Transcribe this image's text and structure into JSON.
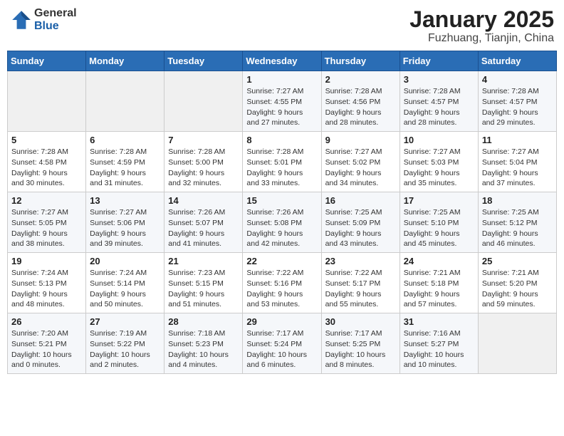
{
  "header": {
    "logo_general": "General",
    "logo_blue": "Blue",
    "month_year": "January 2025",
    "location": "Fuzhuang, Tianjin, China"
  },
  "weekdays": [
    "Sunday",
    "Monday",
    "Tuesday",
    "Wednesday",
    "Thursday",
    "Friday",
    "Saturday"
  ],
  "weeks": [
    [
      {
        "day": "",
        "detail": ""
      },
      {
        "day": "",
        "detail": ""
      },
      {
        "day": "",
        "detail": ""
      },
      {
        "day": "1",
        "detail": "Sunrise: 7:27 AM\nSunset: 4:55 PM\nDaylight: 9 hours\nand 27 minutes."
      },
      {
        "day": "2",
        "detail": "Sunrise: 7:28 AM\nSunset: 4:56 PM\nDaylight: 9 hours\nand 28 minutes."
      },
      {
        "day": "3",
        "detail": "Sunrise: 7:28 AM\nSunset: 4:57 PM\nDaylight: 9 hours\nand 28 minutes."
      },
      {
        "day": "4",
        "detail": "Sunrise: 7:28 AM\nSunset: 4:57 PM\nDaylight: 9 hours\nand 29 minutes."
      }
    ],
    [
      {
        "day": "5",
        "detail": "Sunrise: 7:28 AM\nSunset: 4:58 PM\nDaylight: 9 hours\nand 30 minutes."
      },
      {
        "day": "6",
        "detail": "Sunrise: 7:28 AM\nSunset: 4:59 PM\nDaylight: 9 hours\nand 31 minutes."
      },
      {
        "day": "7",
        "detail": "Sunrise: 7:28 AM\nSunset: 5:00 PM\nDaylight: 9 hours\nand 32 minutes."
      },
      {
        "day": "8",
        "detail": "Sunrise: 7:28 AM\nSunset: 5:01 PM\nDaylight: 9 hours\nand 33 minutes."
      },
      {
        "day": "9",
        "detail": "Sunrise: 7:27 AM\nSunset: 5:02 PM\nDaylight: 9 hours\nand 34 minutes."
      },
      {
        "day": "10",
        "detail": "Sunrise: 7:27 AM\nSunset: 5:03 PM\nDaylight: 9 hours\nand 35 minutes."
      },
      {
        "day": "11",
        "detail": "Sunrise: 7:27 AM\nSunset: 5:04 PM\nDaylight: 9 hours\nand 37 minutes."
      }
    ],
    [
      {
        "day": "12",
        "detail": "Sunrise: 7:27 AM\nSunset: 5:05 PM\nDaylight: 9 hours\nand 38 minutes."
      },
      {
        "day": "13",
        "detail": "Sunrise: 7:27 AM\nSunset: 5:06 PM\nDaylight: 9 hours\nand 39 minutes."
      },
      {
        "day": "14",
        "detail": "Sunrise: 7:26 AM\nSunset: 5:07 PM\nDaylight: 9 hours\nand 41 minutes."
      },
      {
        "day": "15",
        "detail": "Sunrise: 7:26 AM\nSunset: 5:08 PM\nDaylight: 9 hours\nand 42 minutes."
      },
      {
        "day": "16",
        "detail": "Sunrise: 7:25 AM\nSunset: 5:09 PM\nDaylight: 9 hours\nand 43 minutes."
      },
      {
        "day": "17",
        "detail": "Sunrise: 7:25 AM\nSunset: 5:10 PM\nDaylight: 9 hours\nand 45 minutes."
      },
      {
        "day": "18",
        "detail": "Sunrise: 7:25 AM\nSunset: 5:12 PM\nDaylight: 9 hours\nand 46 minutes."
      }
    ],
    [
      {
        "day": "19",
        "detail": "Sunrise: 7:24 AM\nSunset: 5:13 PM\nDaylight: 9 hours\nand 48 minutes."
      },
      {
        "day": "20",
        "detail": "Sunrise: 7:24 AM\nSunset: 5:14 PM\nDaylight: 9 hours\nand 50 minutes."
      },
      {
        "day": "21",
        "detail": "Sunrise: 7:23 AM\nSunset: 5:15 PM\nDaylight: 9 hours\nand 51 minutes."
      },
      {
        "day": "22",
        "detail": "Sunrise: 7:22 AM\nSunset: 5:16 PM\nDaylight: 9 hours\nand 53 minutes."
      },
      {
        "day": "23",
        "detail": "Sunrise: 7:22 AM\nSunset: 5:17 PM\nDaylight: 9 hours\nand 55 minutes."
      },
      {
        "day": "24",
        "detail": "Sunrise: 7:21 AM\nSunset: 5:18 PM\nDaylight: 9 hours\nand 57 minutes."
      },
      {
        "day": "25",
        "detail": "Sunrise: 7:21 AM\nSunset: 5:20 PM\nDaylight: 9 hours\nand 59 minutes."
      }
    ],
    [
      {
        "day": "26",
        "detail": "Sunrise: 7:20 AM\nSunset: 5:21 PM\nDaylight: 10 hours\nand 0 minutes."
      },
      {
        "day": "27",
        "detail": "Sunrise: 7:19 AM\nSunset: 5:22 PM\nDaylight: 10 hours\nand 2 minutes."
      },
      {
        "day": "28",
        "detail": "Sunrise: 7:18 AM\nSunset: 5:23 PM\nDaylight: 10 hours\nand 4 minutes."
      },
      {
        "day": "29",
        "detail": "Sunrise: 7:17 AM\nSunset: 5:24 PM\nDaylight: 10 hours\nand 6 minutes."
      },
      {
        "day": "30",
        "detail": "Sunrise: 7:17 AM\nSunset: 5:25 PM\nDaylight: 10 hours\nand 8 minutes."
      },
      {
        "day": "31",
        "detail": "Sunrise: 7:16 AM\nSunset: 5:27 PM\nDaylight: 10 hours\nand 10 minutes."
      },
      {
        "day": "",
        "detail": ""
      }
    ]
  ]
}
